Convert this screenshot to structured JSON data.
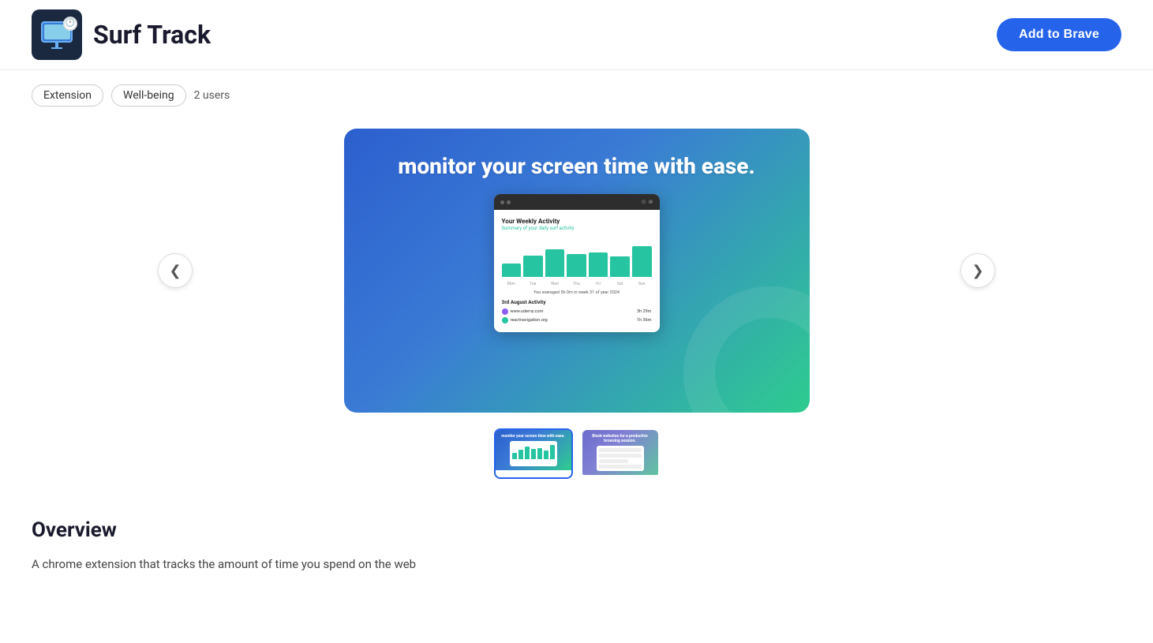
{
  "header": {
    "app_title": "Surf Track",
    "add_button_label": "Add to Brave"
  },
  "tags": {
    "extension_label": "Extension",
    "wellbeing_label": "Well-being",
    "users_label": "2 users"
  },
  "carousel": {
    "headline": "monitor your screen time with ease.",
    "prev_arrow": "‹",
    "next_arrow": "›",
    "mini_browser": {
      "title": "Your Weekly Activity",
      "subtitle": "Summary of your daily surf activity",
      "bars": [
        35,
        42,
        55,
        45,
        48,
        40,
        60
      ],
      "bar_labels": [
        "Mon",
        "Tue",
        "Wed",
        "Thu",
        "Fri",
        "Sat",
        "Sun"
      ],
      "avg_text": "You averaged 5h 0m in week 31 of year 2024",
      "section_title": "3rd August Activity",
      "sites": [
        {
          "name": "www.udemy.com",
          "time": "3h 29m",
          "favicon_color": "#8b5cf6"
        },
        {
          "name": "reactnavigation.org",
          "time": "1h 36m",
          "favicon_color": "#26c4a0"
        }
      ]
    },
    "thumbnails": [
      {
        "label": "monitor your screen time with ease.",
        "active": true
      },
      {
        "label": "Block websites for a productive browsing session.",
        "active": false
      }
    ]
  },
  "overview": {
    "title": "Overview",
    "text": "A chrome extension that tracks the amount of time you spend on the web"
  },
  "icons": {
    "prev": "❮",
    "next": "❯",
    "clock": "🕐"
  }
}
